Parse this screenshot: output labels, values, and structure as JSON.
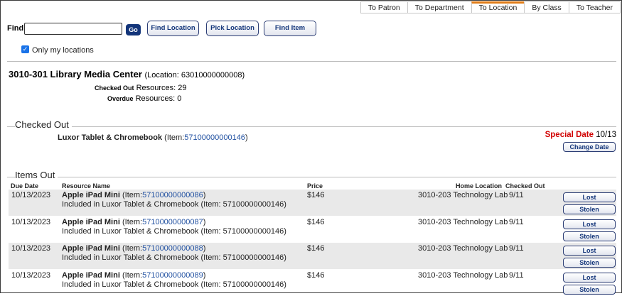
{
  "tabs": [
    {
      "label": "To Patron",
      "active": false
    },
    {
      "label": "To Department",
      "active": false
    },
    {
      "label": "To Location",
      "active": true
    },
    {
      "label": "By Class",
      "active": false
    },
    {
      "label": "To Teacher",
      "active": false
    }
  ],
  "search": {
    "label": "Find",
    "value": "",
    "go_label": "Go",
    "find_location_label": "Find Location",
    "pick_location_label": "Pick Location",
    "find_item_label": "Find Item",
    "only_my_locations_label": "Only my locations",
    "only_my_locations_checked": true
  },
  "location": {
    "name": "3010-301 Library Media Center",
    "id_text": "(Location: 63010000000008)",
    "checked_out_prefix": "Checked Out",
    "checked_out_label": "Resources:",
    "checked_out_count": "29",
    "overdue_prefix": "Overdue",
    "overdue_label": "Resources:",
    "overdue_count": "0"
  },
  "checked_out": {
    "section_title": "Checked Out",
    "item_name": "Luxor Tablet & Chromebook",
    "item_prefix": "(Item:",
    "item_barcode": "57100000000146",
    "item_suffix": ")",
    "special_date_label": "Special Date",
    "special_date_value": "10/13",
    "change_date_label": "Change Date"
  },
  "items_out": {
    "section_title": "Items Out",
    "columns": {
      "due_date": "Due Date",
      "resource_name": "Resource Name",
      "price": "Price",
      "home_location": "Home Location",
      "checked_out": "Checked Out"
    },
    "lost_label": "Lost",
    "stolen_label": "Stolen",
    "rows": [
      {
        "due": "10/13/2023",
        "name": "Apple iPad Mini",
        "item_prefix": "(Item:",
        "barcode": "57100000000086",
        "item_suffix": ")",
        "included": "Included in Luxor Tablet & Chromebook (Item: 57100000000146)",
        "price": "$146",
        "home": "3010-203 Technology Lab",
        "checked": "9/11"
      },
      {
        "due": "10/13/2023",
        "name": "Apple iPad Mini",
        "item_prefix": "(Item:",
        "barcode": "57100000000087",
        "item_suffix": ")",
        "included": "Included in Luxor Tablet & Chromebook (Item: 57100000000146)",
        "price": "$146",
        "home": "3010-203 Technology Lab",
        "checked": "9/11"
      },
      {
        "due": "10/13/2023",
        "name": "Apple iPad Mini",
        "item_prefix": "(Item:",
        "barcode": "57100000000088",
        "item_suffix": ")",
        "included": "Included in Luxor Tablet & Chromebook (Item: 57100000000146)",
        "price": "$146",
        "home": "3010-203 Technology Lab",
        "checked": "9/11"
      },
      {
        "due": "10/13/2023",
        "name": "Apple iPad Mini",
        "item_prefix": "(Item:",
        "barcode": "57100000000089",
        "item_suffix": ")",
        "included": "Included in Luxor Tablet & Chromebook (Item: 57100000000146)",
        "price": "$146",
        "home": "3010-203 Technology Lab",
        "checked": "9/11"
      }
    ]
  }
}
